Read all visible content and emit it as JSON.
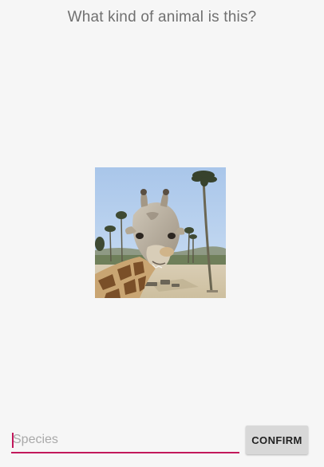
{
  "quiz": {
    "question": "What kind of animal is this?"
  },
  "photo": {
    "subject": "giraffe"
  },
  "answer": {
    "placeholder": "Species",
    "value": "",
    "accent_color": "#c2185b"
  },
  "actions": {
    "confirm_label": "CONFIRM"
  }
}
